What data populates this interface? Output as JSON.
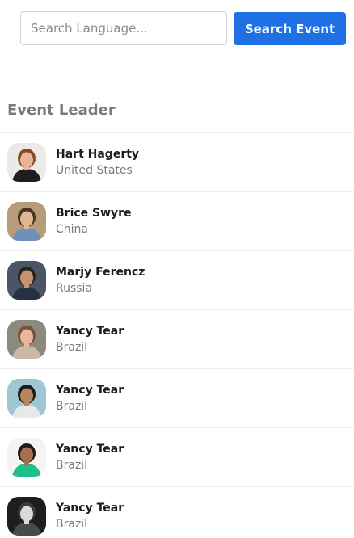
{
  "search": {
    "placeholder": "Search Language...",
    "value": "",
    "button_label": "Search Event"
  },
  "section": {
    "title": "Event Leader"
  },
  "leaders": [
    {
      "name": "Hart Hagerty",
      "country": "United States",
      "avatar": {
        "bg": "#ece9e6",
        "hair": "#8a4a2a",
        "skin": "#e8b49a",
        "shirt": "#1e1e1e"
      }
    },
    {
      "name": "Brice Swyre",
      "country": "China",
      "avatar": {
        "bg": "#b89c7a",
        "hair": "#4a3524",
        "skin": "#e3b692",
        "shirt": "#6f90bd"
      }
    },
    {
      "name": "Marjy Ferencz",
      "country": "Russia",
      "avatar": {
        "bg": "#4a5566",
        "hair": "#2a2420",
        "skin": "#c9926e",
        "shirt": "#26313f"
      }
    },
    {
      "name": "Yancy Tear",
      "country": "Brazil",
      "avatar": {
        "bg": "#8c8a7e",
        "hair": "#7a5236",
        "skin": "#e6b89c",
        "shirt": "#c9b9a6"
      }
    },
    {
      "name": "Yancy Tear",
      "country": "Brazil",
      "avatar": {
        "bg": "#9ec7d4",
        "hair": "#1e1a18",
        "skin": "#b8845e",
        "shirt": "#e8e8e8"
      }
    },
    {
      "name": "Yancy Tear",
      "country": "Brazil",
      "avatar": {
        "bg": "#f4f4f2",
        "hair": "#1e1a18",
        "skin": "#a4704e",
        "shirt": "#1fbf8a"
      }
    },
    {
      "name": "Yancy Tear",
      "country": "Brazil",
      "avatar": {
        "bg": "#1e1e1e",
        "hair": "#3a3a3a",
        "skin": "#d9d9d9",
        "shirt": "#4a4a4a"
      }
    }
  ]
}
